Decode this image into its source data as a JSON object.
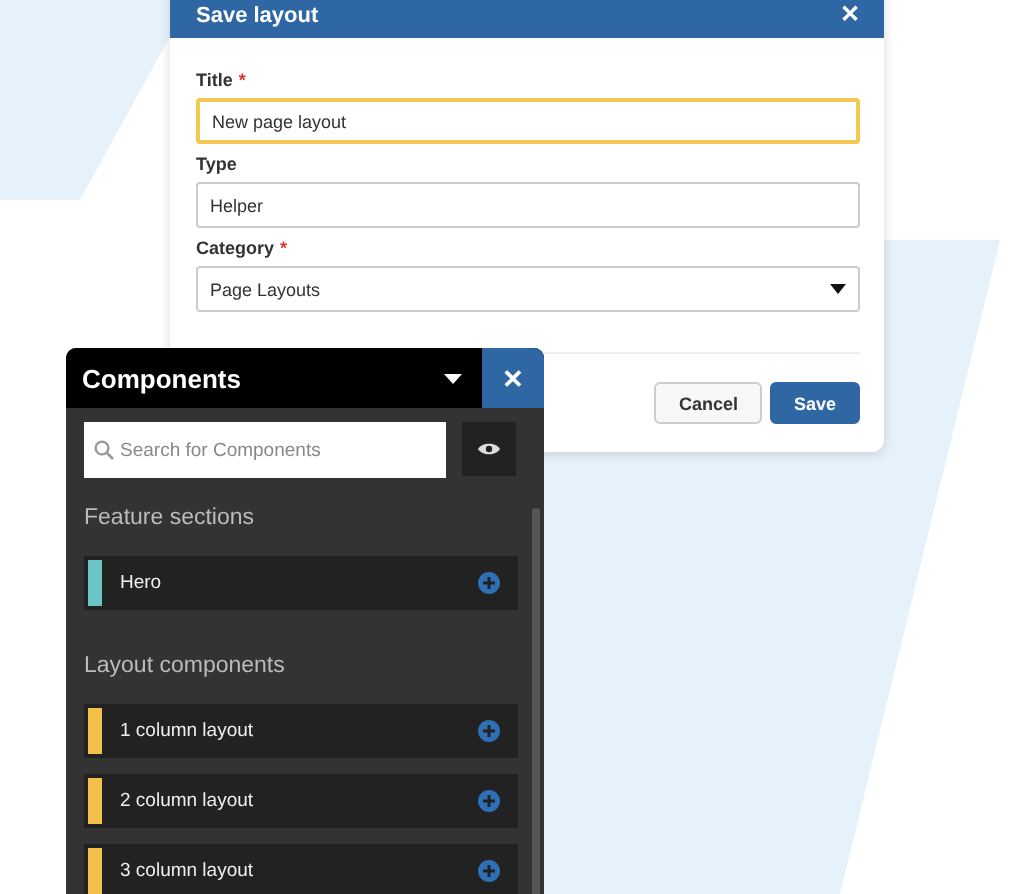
{
  "dialog": {
    "title": "Save layout",
    "close": "✕",
    "fields": [
      {
        "kind": "text",
        "label": "Title",
        "required_mark": "*",
        "value": "New page layout",
        "focused": true
      },
      {
        "kind": "text",
        "label": "Type",
        "value": "Helper",
        "focused": false
      },
      {
        "kind": "select",
        "label": "Category",
        "required_mark": "*",
        "value": "Page Layouts",
        "focused": false
      }
    ],
    "buttons": [
      {
        "label": "Cancel",
        "primary": false
      },
      {
        "label": "Save",
        "primary": true
      }
    ]
  },
  "panel": {
    "title": "Components",
    "close": "✕",
    "search": {
      "placeholder": "Search for Components"
    },
    "sections": [
      {
        "heading": "Feature sections",
        "items": [
          {
            "label": "Hero",
            "color": "#6cc5c5"
          }
        ]
      },
      {
        "heading": "Layout components",
        "items": [
          {
            "label": "1 column layout",
            "color": "#f5c04a"
          },
          {
            "label": "2 column layout",
            "color": "#f5c04a"
          },
          {
            "label": "3 column layout",
            "color": "#f5c04a"
          }
        ]
      }
    ]
  }
}
